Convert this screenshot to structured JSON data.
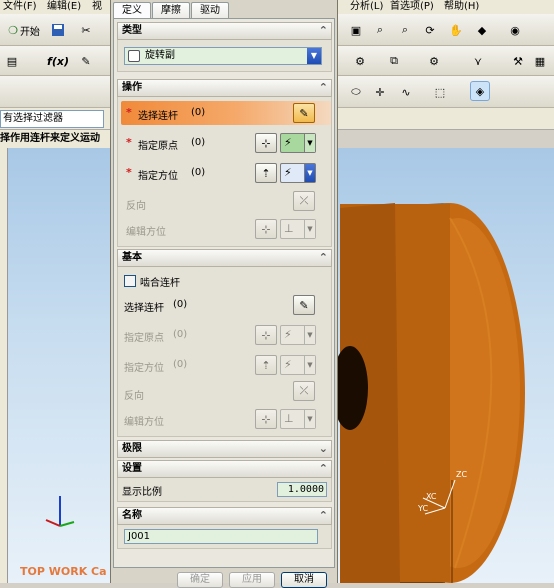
{
  "app": {
    "menu": [
      "文件(F)",
      "编辑(E)",
      "视",
      "分析(L)",
      "首选项(P)",
      "帮助(H)"
    ],
    "start_label": "开始",
    "filter_value": "有选择过滤器",
    "hint_text": "择作用连杆来定义运动",
    "brand": "TOP WORK Ca"
  },
  "dialog": {
    "tabs": [
      "定义",
      "摩擦",
      "驱动"
    ],
    "active_tab": 0,
    "type_section": {
      "title": "类型",
      "value": "旋转副"
    },
    "action_section": {
      "title": "操作",
      "rows": [
        {
          "label": "选择连杆",
          "value": "(0)",
          "required": true,
          "state": "selected"
        },
        {
          "label": "指定原点",
          "value": "(0)",
          "required": true,
          "state": "normal"
        },
        {
          "label": "指定方位",
          "value": "(0)",
          "required": true,
          "state": "normal"
        },
        {
          "label": "反向",
          "state": "disabled"
        },
        {
          "label": "编辑方位",
          "state": "disabled"
        }
      ]
    },
    "basic_section": {
      "title": "基本",
      "checkbox_label": "啮合连杆",
      "rows": [
        {
          "label": "选择连杆",
          "value": "(0)",
          "state": "normal"
        },
        {
          "label": "指定原点",
          "value": "(0)",
          "state": "disabled"
        },
        {
          "label": "指定方位",
          "value": "(0)",
          "state": "disabled"
        },
        {
          "label": "反向",
          "state": "disabled"
        },
        {
          "label": "编辑方位",
          "state": "disabled"
        }
      ]
    },
    "limits_section": {
      "title": "极限"
    },
    "settings_section": {
      "title": "设置",
      "scale_label": "显示比例",
      "scale_value": "1.0000"
    },
    "name_section": {
      "title": "名称",
      "value": "J001"
    },
    "buttons": {
      "ok": "确定",
      "apply": "应用",
      "cancel": "取消"
    }
  },
  "triad": {
    "x": "XC",
    "y": "YC",
    "z": "ZC"
  },
  "colors": {
    "part": "#c56a13",
    "part_dark": "#8a4506",
    "accent": "#f08a3a",
    "field_bg": "#e1f1dd"
  }
}
